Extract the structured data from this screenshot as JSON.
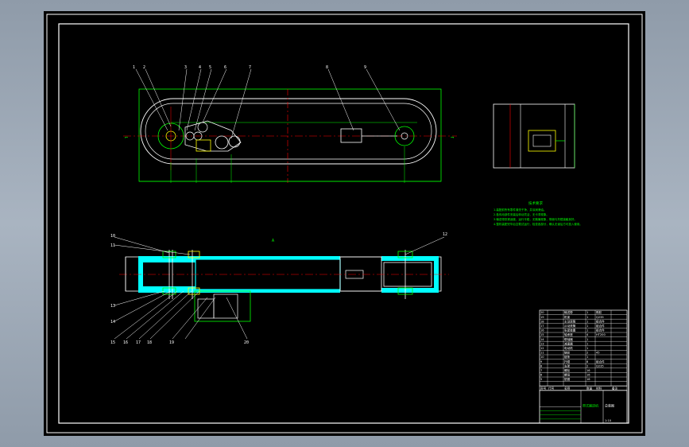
{
  "drawing": {
    "top_view_label": "A",
    "notes_title": "技术要求",
    "notes": [
      "1.装配前所有零件清洗干净，并涂润滑油。",
      "2.各传动部件安装后转动灵活，无卡滞现象。",
      "3.输送带张紧适度，运行平稳，无跑偏现象，带面与托辊接触良好。",
      "4.整机装配完毕后空载试运行，检查各部分，确认无误后方可投入使用。"
    ],
    "leaders_top": [
      "1",
      "2",
      "3",
      "4",
      "5",
      "6",
      "7",
      "8",
      "9"
    ],
    "leaders_bottom": [
      "10",
      "11",
      "12",
      "13",
      "14",
      "15",
      "16",
      "17",
      "18",
      "19",
      "20"
    ]
  },
  "title_block": {
    "header_cols": [
      "序号",
      "代号",
      "名称",
      "数量",
      "材料",
      "备注"
    ],
    "rows": [
      [
        "20",
        "",
        "输送带",
        "1",
        "橡胶",
        ""
      ],
      [
        "19",
        "",
        "机架",
        "1",
        "Q235",
        ""
      ],
      [
        "18",
        "",
        "主动滚筒",
        "1",
        "组合件",
        ""
      ],
      [
        "17",
        "",
        "从动滚筒",
        "1",
        "组合件",
        ""
      ],
      [
        "16",
        "",
        "张紧装置",
        "1",
        "组合件",
        ""
      ],
      [
        "15",
        "",
        "轴承座",
        "4",
        "HT200",
        ""
      ],
      [
        "14",
        "",
        "联轴器",
        "1",
        "",
        ""
      ],
      [
        "13",
        "",
        "减速器",
        "1",
        "",
        ""
      ],
      [
        "12",
        "",
        "电动机",
        "1",
        "",
        ""
      ],
      [
        "11",
        "",
        "链轮",
        "2",
        "45",
        ""
      ],
      [
        "10",
        "",
        "链条",
        "1",
        "",
        ""
      ],
      [
        "9",
        "",
        "托辊",
        "8",
        "组合件",
        ""
      ],
      [
        "8",
        "",
        "支架",
        "2",
        "Q235",
        ""
      ],
      [
        "7",
        "",
        "螺栓",
        "16",
        "",
        ""
      ],
      [
        "6",
        "",
        "螺母",
        "16",
        "",
        ""
      ],
      [
        "5",
        "",
        "垫圈",
        "16",
        "",
        ""
      ]
    ],
    "drawing_title": "带式输送机",
    "drawing_no": "总装图",
    "scale": "1:10"
  },
  "colors": {
    "background": "#000000",
    "frame": "#ffffff",
    "outline": "#00ff00",
    "centerline": "#ff0000",
    "section": "#00ffff",
    "detail": "#ffff00",
    "dimension": "#ff00ff"
  }
}
